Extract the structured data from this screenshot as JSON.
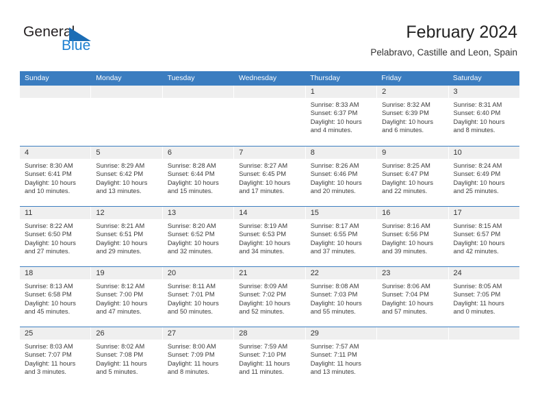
{
  "brand": {
    "name_part1": "General",
    "name_part2": "Blue",
    "triangle_color": "#1b6db5",
    "blue_color": "#1b7fd1"
  },
  "header": {
    "title": "February 2024",
    "subtitle": "Pelabravo, Castille and Leon, Spain"
  },
  "theme": {
    "header_blue": "#3b7dc0",
    "day_band_grey": "#efefef",
    "text": "#3a3a3a"
  },
  "weekdays": [
    "Sunday",
    "Monday",
    "Tuesday",
    "Wednesday",
    "Thursday",
    "Friday",
    "Saturday"
  ],
  "weeks": [
    [
      {
        "day": "",
        "lines": []
      },
      {
        "day": "",
        "lines": []
      },
      {
        "day": "",
        "lines": []
      },
      {
        "day": "",
        "lines": []
      },
      {
        "day": "1",
        "lines": [
          "Sunrise: 8:33 AM",
          "Sunset: 6:37 PM",
          "Daylight: 10 hours",
          "and 4 minutes."
        ]
      },
      {
        "day": "2",
        "lines": [
          "Sunrise: 8:32 AM",
          "Sunset: 6:39 PM",
          "Daylight: 10 hours",
          "and 6 minutes."
        ]
      },
      {
        "day": "3",
        "lines": [
          "Sunrise: 8:31 AM",
          "Sunset: 6:40 PM",
          "Daylight: 10 hours",
          "and 8 minutes."
        ]
      }
    ],
    [
      {
        "day": "4",
        "lines": [
          "Sunrise: 8:30 AM",
          "Sunset: 6:41 PM",
          "Daylight: 10 hours",
          "and 10 minutes."
        ]
      },
      {
        "day": "5",
        "lines": [
          "Sunrise: 8:29 AM",
          "Sunset: 6:42 PM",
          "Daylight: 10 hours",
          "and 13 minutes."
        ]
      },
      {
        "day": "6",
        "lines": [
          "Sunrise: 8:28 AM",
          "Sunset: 6:44 PM",
          "Daylight: 10 hours",
          "and 15 minutes."
        ]
      },
      {
        "day": "7",
        "lines": [
          "Sunrise: 8:27 AM",
          "Sunset: 6:45 PM",
          "Daylight: 10 hours",
          "and 17 minutes."
        ]
      },
      {
        "day": "8",
        "lines": [
          "Sunrise: 8:26 AM",
          "Sunset: 6:46 PM",
          "Daylight: 10 hours",
          "and 20 minutes."
        ]
      },
      {
        "day": "9",
        "lines": [
          "Sunrise: 8:25 AM",
          "Sunset: 6:47 PM",
          "Daylight: 10 hours",
          "and 22 minutes."
        ]
      },
      {
        "day": "10",
        "lines": [
          "Sunrise: 8:24 AM",
          "Sunset: 6:49 PM",
          "Daylight: 10 hours",
          "and 25 minutes."
        ]
      }
    ],
    [
      {
        "day": "11",
        "lines": [
          "Sunrise: 8:22 AM",
          "Sunset: 6:50 PM",
          "Daylight: 10 hours",
          "and 27 minutes."
        ]
      },
      {
        "day": "12",
        "lines": [
          "Sunrise: 8:21 AM",
          "Sunset: 6:51 PM",
          "Daylight: 10 hours",
          "and 29 minutes."
        ]
      },
      {
        "day": "13",
        "lines": [
          "Sunrise: 8:20 AM",
          "Sunset: 6:52 PM",
          "Daylight: 10 hours",
          "and 32 minutes."
        ]
      },
      {
        "day": "14",
        "lines": [
          "Sunrise: 8:19 AM",
          "Sunset: 6:53 PM",
          "Daylight: 10 hours",
          "and 34 minutes."
        ]
      },
      {
        "day": "15",
        "lines": [
          "Sunrise: 8:17 AM",
          "Sunset: 6:55 PM",
          "Daylight: 10 hours",
          "and 37 minutes."
        ]
      },
      {
        "day": "16",
        "lines": [
          "Sunrise: 8:16 AM",
          "Sunset: 6:56 PM",
          "Daylight: 10 hours",
          "and 39 minutes."
        ]
      },
      {
        "day": "17",
        "lines": [
          "Sunrise: 8:15 AM",
          "Sunset: 6:57 PM",
          "Daylight: 10 hours",
          "and 42 minutes."
        ]
      }
    ],
    [
      {
        "day": "18",
        "lines": [
          "Sunrise: 8:13 AM",
          "Sunset: 6:58 PM",
          "Daylight: 10 hours",
          "and 45 minutes."
        ]
      },
      {
        "day": "19",
        "lines": [
          "Sunrise: 8:12 AM",
          "Sunset: 7:00 PM",
          "Daylight: 10 hours",
          "and 47 minutes."
        ]
      },
      {
        "day": "20",
        "lines": [
          "Sunrise: 8:11 AM",
          "Sunset: 7:01 PM",
          "Daylight: 10 hours",
          "and 50 minutes."
        ]
      },
      {
        "day": "21",
        "lines": [
          "Sunrise: 8:09 AM",
          "Sunset: 7:02 PM",
          "Daylight: 10 hours",
          "and 52 minutes."
        ]
      },
      {
        "day": "22",
        "lines": [
          "Sunrise: 8:08 AM",
          "Sunset: 7:03 PM",
          "Daylight: 10 hours",
          "and 55 minutes."
        ]
      },
      {
        "day": "23",
        "lines": [
          "Sunrise: 8:06 AM",
          "Sunset: 7:04 PM",
          "Daylight: 10 hours",
          "and 57 minutes."
        ]
      },
      {
        "day": "24",
        "lines": [
          "Sunrise: 8:05 AM",
          "Sunset: 7:05 PM",
          "Daylight: 11 hours",
          "and 0 minutes."
        ]
      }
    ],
    [
      {
        "day": "25",
        "lines": [
          "Sunrise: 8:03 AM",
          "Sunset: 7:07 PM",
          "Daylight: 11 hours",
          "and 3 minutes."
        ]
      },
      {
        "day": "26",
        "lines": [
          "Sunrise: 8:02 AM",
          "Sunset: 7:08 PM",
          "Daylight: 11 hours",
          "and 5 minutes."
        ]
      },
      {
        "day": "27",
        "lines": [
          "Sunrise: 8:00 AM",
          "Sunset: 7:09 PM",
          "Daylight: 11 hours",
          "and 8 minutes."
        ]
      },
      {
        "day": "28",
        "lines": [
          "Sunrise: 7:59 AM",
          "Sunset: 7:10 PM",
          "Daylight: 11 hours",
          "and 11 minutes."
        ]
      },
      {
        "day": "29",
        "lines": [
          "Sunrise: 7:57 AM",
          "Sunset: 7:11 PM",
          "Daylight: 11 hours",
          "and 13 minutes."
        ]
      },
      {
        "day": "",
        "lines": []
      },
      {
        "day": "",
        "lines": []
      }
    ]
  ]
}
